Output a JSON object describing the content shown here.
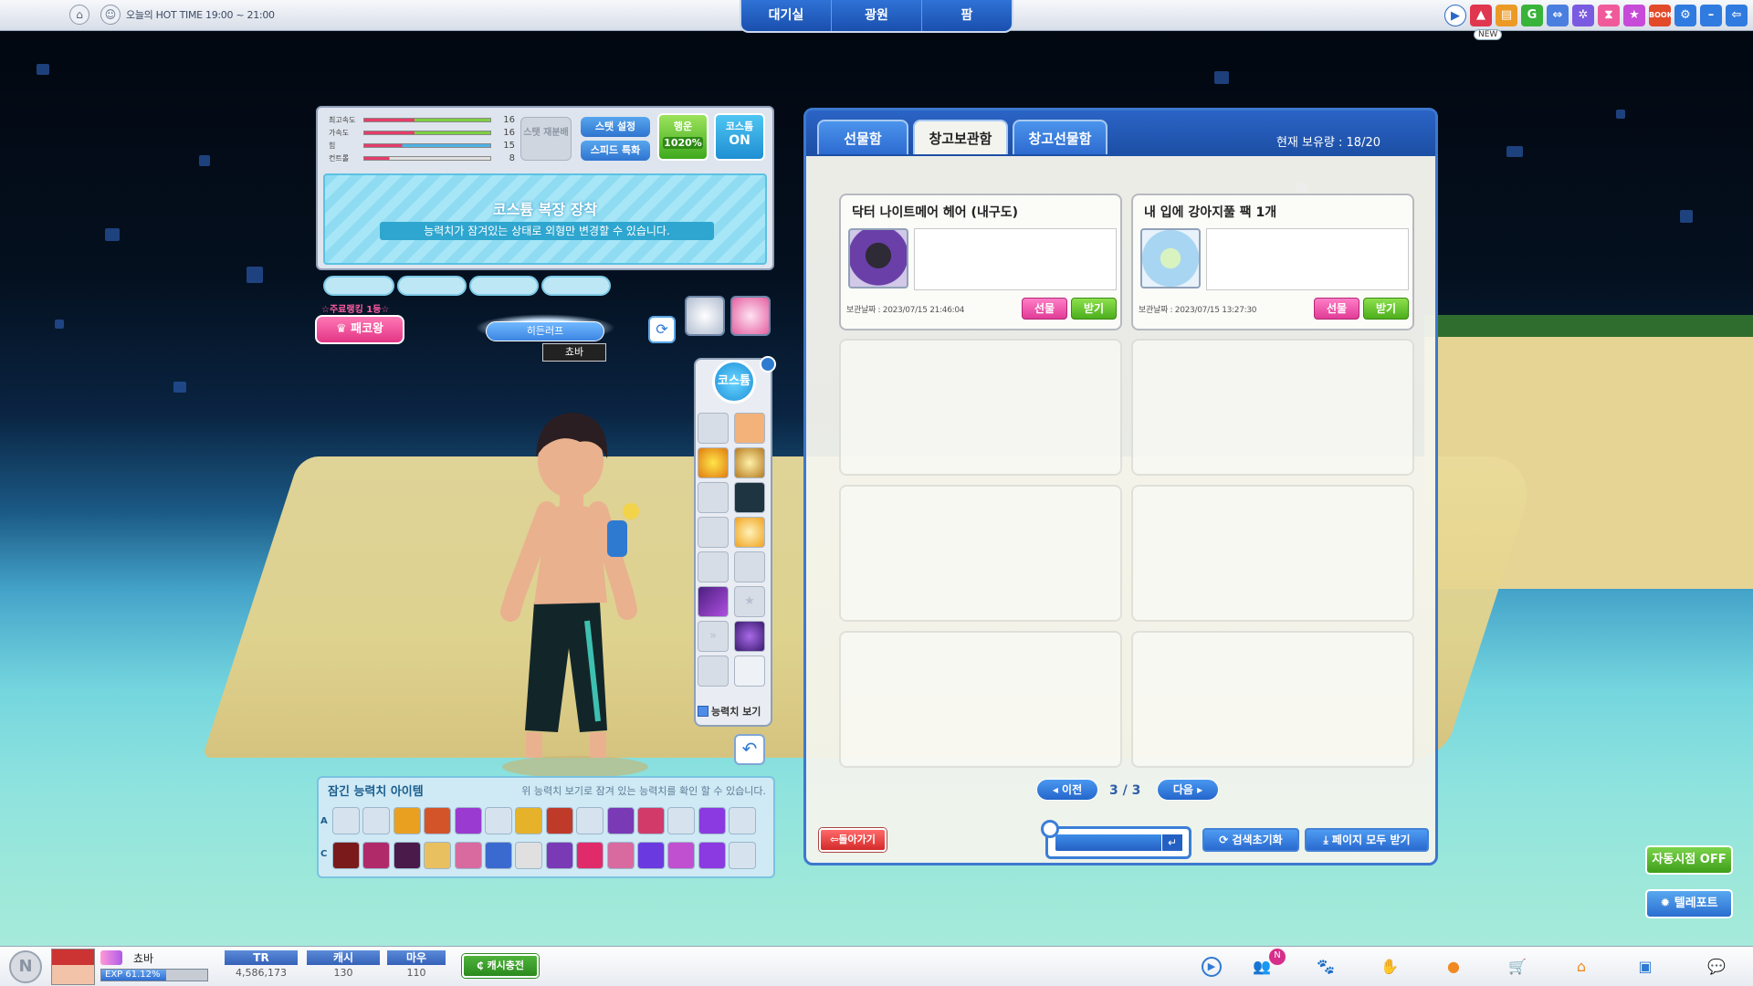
{
  "topbar": {
    "hot_time": "오늘의 HOT TIME 19:00 ~ 21:00",
    "tabs": [
      "대기실",
      "광원",
      "팜"
    ],
    "new_badge": "NEW",
    "right_icons": [
      "play-icon",
      "fire-icon",
      "book-icon",
      "g-icon",
      "swap-icon",
      "gear-alt-icon",
      "hourglass-icon",
      "star-icon",
      "book2-icon",
      "settings-icon",
      "minimize-icon",
      "back-icon"
    ]
  },
  "stats": {
    "rows": [
      {
        "label": "최고속도",
        "value": "16"
      },
      {
        "label": "가속도",
        "value": "16"
      },
      {
        "label": "힘",
        "value": "15"
      },
      {
        "label": "컨트롤",
        "value": "8"
      }
    ],
    "stat_reset": "스탯 재분배",
    "stat_setting": "스탯 설정",
    "speed_special": "스피드 특화",
    "luck_label": "행운",
    "luck_value": "1020%",
    "costume_label": "코스튬",
    "costume_state": "ON",
    "banner_title": "코스튬 복장 장착",
    "banner_desc": "능력치가 잠겨있는 상태로 외형만 변경할 수 있습니다."
  },
  "hero": {
    "rank_tag": "☆주료랭킹 1등☆",
    "champion": "패코왕",
    "wing_title": "히든러프",
    "nickname": "쵸바"
  },
  "equipment": {
    "costume_button": "코스튬",
    "ability_view": "능력치 보기"
  },
  "locked": {
    "title": "잠긴 능력치 아이템",
    "desc": "위 능력치 보기로 잠겨 있는 능력치를 확인 할 수 있습니다.",
    "row_labels": [
      "A",
      "C"
    ]
  },
  "storage": {
    "tabs": [
      "선물함",
      "창고보관함",
      "창고선물함"
    ],
    "owned": "현재 보유량 : 18/20",
    "items": [
      {
        "name": "닥터 나이트메어 헤어 (내구도)",
        "date": "보관날짜 :   2023/07/15 21:46:04",
        "gift": "선물",
        "receive": "받기"
      },
      {
        "name": "내 입에 강아지풀 팩 1개",
        "date": "보관날짜 :   2023/07/15 13:27:30",
        "gift": "선물",
        "receive": "받기"
      }
    ],
    "prev": "이전",
    "next": "다음",
    "page": "3 / 3",
    "back": "돌아가기",
    "search_placeholder": "",
    "reset_search": "검색초기화",
    "receive_all": "페이지 모두 받기"
  },
  "side": {
    "auto_view": "자동시점 OFF",
    "teleport": "텔레포트"
  },
  "bottom": {
    "player_name": "쵸바",
    "exp": "EXP 61.12%",
    "exp_fraction": 0.6112,
    "tr_label": "TR",
    "tr_value": "4,586,173",
    "cash_label": "캐시",
    "cash_value": "130",
    "mau_label": "마우",
    "mau_value": "110",
    "charge": "캐시충전"
  }
}
